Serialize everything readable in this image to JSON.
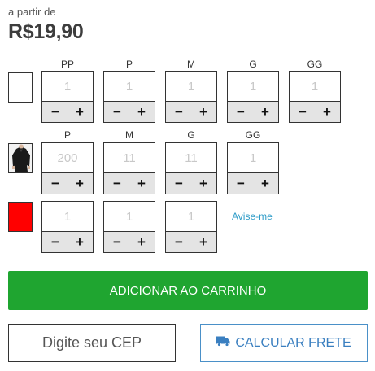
{
  "price": {
    "prefix": "a partir de",
    "value": "R$19,90"
  },
  "variants": [
    {
      "swatch": "white",
      "sizes": [
        {
          "label": "PP",
          "qty": "1"
        },
        {
          "label": "P",
          "qty": "1"
        },
        {
          "label": "M",
          "qty": "1"
        },
        {
          "label": "G",
          "qty": "1"
        },
        {
          "label": "GG",
          "qty": "1"
        }
      ]
    },
    {
      "swatch": "black-blouse-photo",
      "sizes": [
        {
          "label": "P",
          "qty": "200"
        },
        {
          "label": "M",
          "qty": "11"
        },
        {
          "label": "G",
          "qty": "11"
        },
        {
          "label": "GG",
          "qty": "1"
        }
      ]
    },
    {
      "swatch": "red",
      "sizes": [
        {
          "qty": "1"
        },
        {
          "qty": "1"
        },
        {
          "qty": "1"
        }
      ],
      "notify_label": "Avise-me"
    }
  ],
  "controls": {
    "minus": "−",
    "plus": "+"
  },
  "actions": {
    "add_to_cart": "ADICIONAR AO CARRINHO",
    "cep_placeholder": "Digite seu CEP",
    "calc_freight": "CALCULAR FRETE"
  },
  "colors": {
    "cart_green": "#1fa530",
    "link_blue": "#2e9cc8",
    "swatch_red": "#ff0000"
  },
  "icons": {
    "freight": "truck-icon"
  }
}
